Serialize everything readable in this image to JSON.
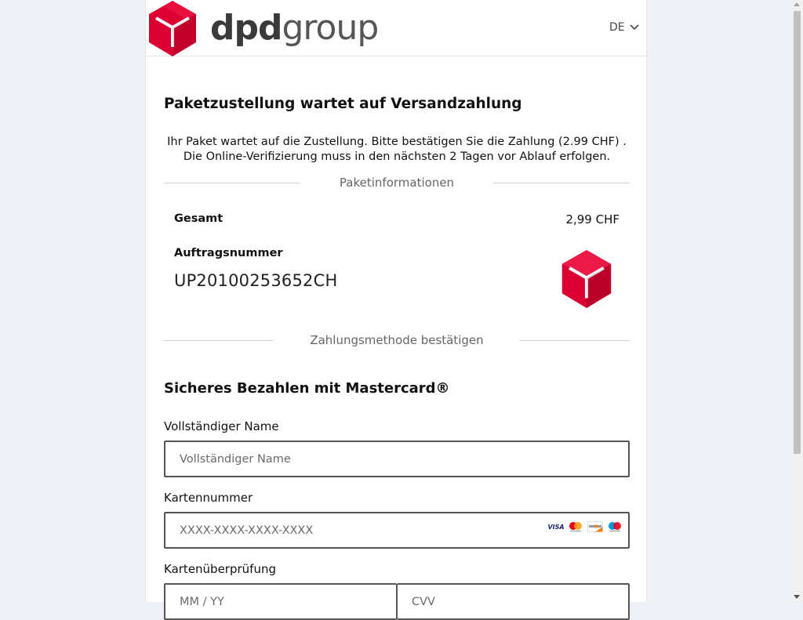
{
  "header": {
    "brand_bold": "dpd",
    "brand_light": "group",
    "language": "DE"
  },
  "main": {
    "title": "Paketzustellung wartet auf Versandzahlung",
    "intro_line1": "Ihr Paket wartet auf die Zustellung. Bitte bestätigen Sie die Zahlung (2.99 CHF) .",
    "intro_line2": "Die Online-Verifizierung muss in den nächsten 2 Tagen vor Ablauf erfolgen.",
    "package_section_label": "Paketinformationen",
    "total_label": "Gesamt",
    "total_value": "2,99 CHF",
    "order_label": "Auftragsnummer",
    "order_number": "UP20100253652CH",
    "payment_section_label": "Zahlungsmethode bestätigen",
    "secure_title": "Sicheres Bezahlen mit Mastercard®"
  },
  "form": {
    "name_label": "Vollständiger Name",
    "name_placeholder": "Vollständiger Name",
    "card_label": "Kartennummer",
    "card_placeholder": "XXXX-XXXX-XXXX-XXXX",
    "verify_label": "Kartenüberprüfung",
    "expiry_placeholder": "MM / YY",
    "cvv_placeholder": "CVV"
  },
  "card_brands": [
    "VISA",
    "mastercard",
    "DISCOVER",
    "maestro"
  ],
  "colors": {
    "brand_red": "#dc0032",
    "text": "#111111",
    "page_bg": "#eef1f5"
  }
}
